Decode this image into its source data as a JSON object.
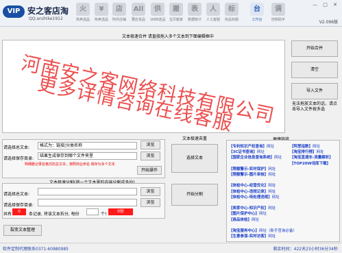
{
  "header": {
    "logo_badge": "VIP",
    "title": "安之客店淘",
    "subtitle": "QQ:anzhike1912",
    "version": "V2.096版",
    "window_controls": "— □ ✕",
    "toolbar": [
      {
        "label": "热卖选品",
        "glyph": "火",
        "active": false
      },
      {
        "label": "热卖选品",
        "glyph": "¥",
        "active": false
      },
      {
        "label": "阿月店铺",
        "glyph": "店",
        "active": false
      },
      {
        "label": "要店货品",
        "glyph": "All",
        "active": false
      },
      {
        "label": "1688选品",
        "glyph": "供",
        "active": false
      },
      {
        "label": "宝贝搬家",
        "glyph": "搬",
        "active": false
      },
      {
        "label": "数据统计",
        "glyph": "表",
        "active": false
      },
      {
        "label": "人工客服",
        "glyph": "人",
        "active": false
      },
      {
        "label": "商品标题",
        "glyph": "标",
        "active": false
      },
      {
        "label": "工作台",
        "glyph": "台",
        "active": true
      },
      {
        "label": "控制助手",
        "glyph": "调",
        "active": false
      }
    ]
  },
  "merge": {
    "header": "文本极速合并  请直接拖入多个文本到下面编辑框中",
    "start_button": "开始合并",
    "clear_button": "清空",
    "import_button": "导入文件",
    "hint": "无法拖放文本的话，请点击导入文件按多选"
  },
  "dedup": {
    "header": "文本极速去重",
    "source_label": "请选择总文本:",
    "source_value": "格式为：链接|分类名称",
    "save_label": "请选择保存目录:",
    "save_value": "结果生成保存到哪个文件夹里",
    "browse1": "浏览",
    "browse2": "浏览",
    "warning": "明细删记录名格式的总文本，按照商业命名 保存为多个文本",
    "start_button": "开始操作",
    "choose_button": "选择文本"
  },
  "split": {
    "header": "文本极速分割(将一个文本里的内容分割成多份)",
    "source_label": "请选择总文本:",
    "save_label": "请选择保存目录:",
    "browse1": "浏览",
    "browse2": "浏览",
    "count_prefix": "共有",
    "count_value": "0",
    "count_mid": "条记录, 将该文本拆分, 每份",
    "per_part_value": "",
    "count_suffix": "个!",
    "result_value": "0份",
    "start_button": "开始分割",
    "cleanup_button": "裂变文本整理"
  },
  "links": {
    "header": "便捷链接",
    "left": [
      {
        "name": "【专利知识产权查询】",
        "tail": "网址"
      },
      {
        "name": "【3C证书查询】",
        "tail": "网址"
      },
      {
        "name": "【国家企业信息查询系统】",
        "tail": "网址"
      },
      {
        "name": "",
        "tail": ""
      },
      {
        "name": "【限额警示-实时保护】",
        "tail": "网址"
      },
      {
        "name": "【限额警示-图片审核】",
        "tail": "网址"
      },
      {
        "name": "",
        "tail": ""
      },
      {
        "name": "【体检中心-经营优化】",
        "tail": "网址"
      },
      {
        "name": "【体检中心-违规记录】",
        "tail": "网址"
      },
      {
        "name": "【体检中心-待处理违规】",
        "tail": "网址"
      },
      {
        "name": "",
        "tail": ""
      },
      {
        "name": "【卖家中心-知识产权】",
        "tail": "网址"
      },
      {
        "name": "【图片保护中心】",
        "tail": "网址"
      },
      {
        "name": "【商品体检】",
        "tail": "网址"
      },
      {
        "name": "",
        "tail": ""
      },
      {
        "name": "【淘宝服务中心】",
        "tail": "网址（新手查询必备）"
      },
      {
        "name": "【生意参谋-实时访客】",
        "tail": "网址"
      }
    ],
    "right": [
      {
        "name": "【阿里指数】",
        "tail": "网址"
      },
      {
        "name": "【淘宝排行榜】",
        "tail": "网址"
      },
      {
        "name": "【淘宝直通车-流量解析】",
        "tail": ""
      },
      {
        "name": "【TOP20W词库下载】",
        "tail": ""
      }
    ]
  },
  "watermark": {
    "line1": "河南安之客网络科技有限公司",
    "line2": "更多详情咨询在线客服"
  },
  "footer": {
    "left": "软件定制代理联系0371-60980985",
    "right": "剩余时间：422天23小时36分34秒"
  }
}
